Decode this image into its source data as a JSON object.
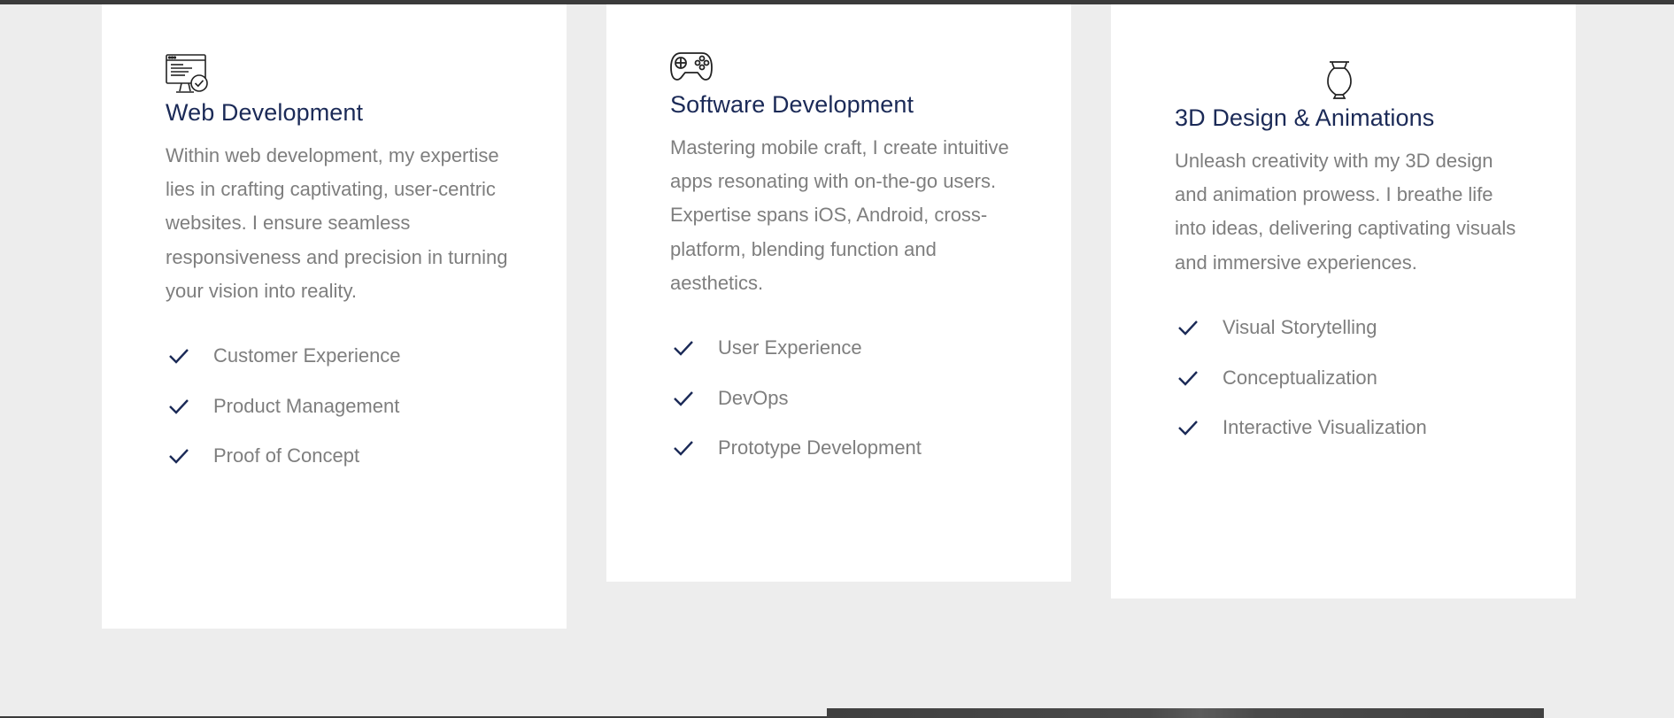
{
  "colors": {
    "accent": "#1b2a57",
    "body_text": "#7e7e7e",
    "card_bg": "#ffffff",
    "page_bg": "#ededed"
  },
  "cards": [
    {
      "icon": "monitor-check-icon",
      "title": "Web Development",
      "description": "Within web development, my expertise lies in crafting captivating, user-centric websites. I ensure seamless responsiveness and precision in turning your vision into reality.",
      "features": [
        "Customer Experience",
        "Product Management",
        "Proof of Concept"
      ]
    },
    {
      "icon": "gamepad-icon",
      "title": "Software Development",
      "description": "Mastering mobile craft, I create intuitive apps resonating with on-the-go users. Expertise spans iOS, Android, cross-platform, blending function and aesthetics.",
      "features": [
        "User Experience",
        "DevOps",
        "Prototype Development"
      ]
    },
    {
      "icon": "vase-icon",
      "title": "3D Design & Animations",
      "description": "Unleash creativity with my 3D design and animation prowess. I breathe life into ideas, delivering captivating visuals and immersive experiences.",
      "features": [
        "Visual Storytelling",
        "Conceptualization",
        "Interactive Visualization"
      ]
    }
  ]
}
